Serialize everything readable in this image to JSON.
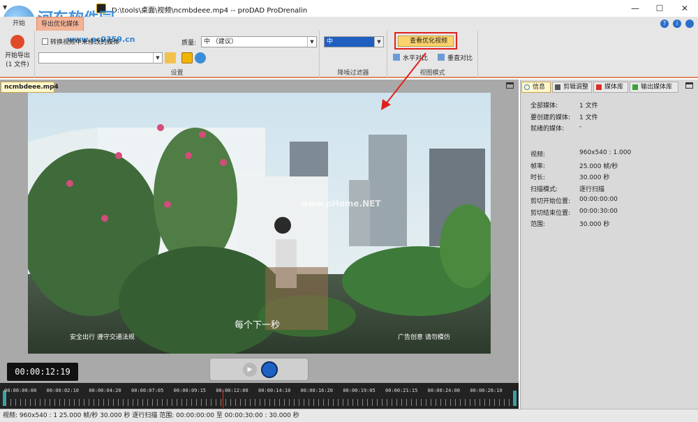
{
  "titlebar": {
    "title": "D:\\tools\\桌面\\视频\\ncmbdeee.mp4 -- proDAD ProDrenalin",
    "watermark": "河东软件园",
    "watermark_url": "www.pc0359.cn",
    "minimize": "—",
    "maximize": "☐",
    "close": "✕"
  },
  "ribbon": {
    "tabs": [
      "开始",
      "导出优化媒体"
    ],
    "export_button": "开始导出",
    "export_sub": "(1 文件)",
    "checkbox_label": "转换视频中未修改的媒体",
    "quality_label": "质量:",
    "quality_value": "中 （建议）",
    "settings_group": "设置",
    "denoise_value": "中",
    "denoise_group": "降噪过滤器",
    "view_optimized": "查看优化视频",
    "compare_h": "水平对比",
    "compare_v": "垂直对比",
    "view_group": "视图模式"
  },
  "document": {
    "tab": "ncmbdeee.mp4",
    "subtitle": "每个下一秒",
    "left_caption": "安全出行 遵守交通法规",
    "right_caption": "广告创意 请勿模仿",
    "video_watermark": "www.pHome.NET",
    "timecode": "00:00:12:19",
    "timeline_ticks": [
      "00:00:00:00",
      "00:00:02:10",
      "00:00:04:20",
      "00:00:07:05",
      "00:00:09:15",
      "00:00:12:00",
      "00:00:14:10",
      "00:00:16:20",
      "00:00:19:05",
      "00:00:21:15",
      "00:00:24:00",
      "00:00:26:10"
    ]
  },
  "panel": {
    "tabs": [
      "信息",
      "剪辑调整",
      "媒体库",
      "输出媒体库"
    ],
    "tab_colors": [
      "#2e7fd8",
      "#555555",
      "#d9302c",
      "#3aa33a"
    ],
    "group1": [
      {
        "label": "全部媒体:",
        "value": "1 文件"
      },
      {
        "label": "要创建的媒体:",
        "value": "1 文件"
      },
      {
        "label": "就绪的媒体:",
        "value": "-"
      }
    ],
    "group2": [
      {
        "label": "视频:",
        "value": "960x540 : 1.000"
      },
      {
        "label": "帧率:",
        "value": "25.000 帧/秒"
      },
      {
        "label": "时长:",
        "value": "30.000 秒"
      },
      {
        "label": "扫描模式:",
        "value": "逐行扫描"
      },
      {
        "label": "剪切开始位置:",
        "value": "00:00:00:00"
      },
      {
        "label": "剪切结束位置:",
        "value": "00:00:30:00"
      },
      {
        "label": "范围:",
        "value": "30.000 秒"
      }
    ]
  },
  "status": "视频: 960x540 : 1  25.000 帧/秒  30.000 秒  逐行扫描  范围: 00:00:00:00 至 00:00:30:00 : 30.000 秒",
  "colors": {
    "accent": "#e08a60",
    "highlight_box": "#e0201c"
  }
}
